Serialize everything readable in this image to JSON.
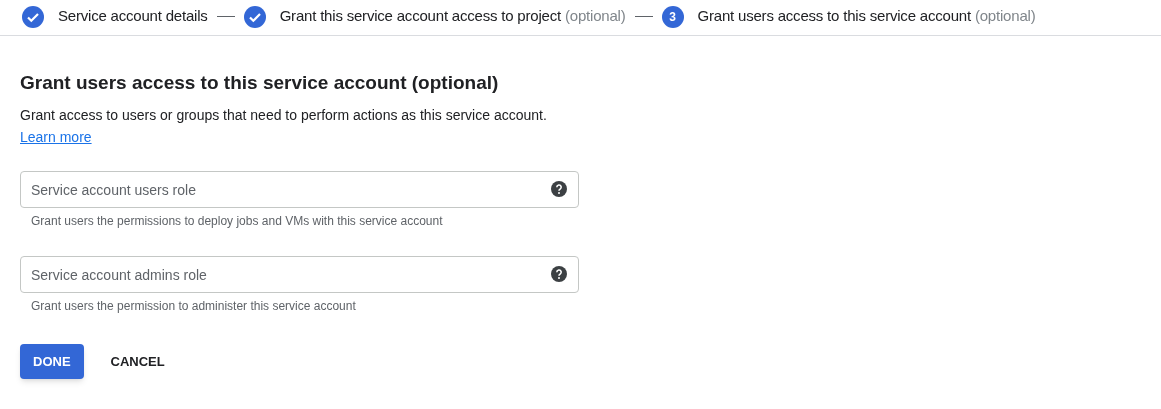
{
  "stepper": [
    {
      "label": "Service account details",
      "completed": true
    },
    {
      "label": "Grant this service account access to project",
      "note": "(optional)",
      "completed": true
    },
    {
      "label": "Grant users access to this service account",
      "note": "(optional)",
      "completed": false,
      "number": "3"
    }
  ],
  "section": {
    "title": "Grant users access to this service account (optional)",
    "description": "Grant access to users or groups that need to perform actions as this service account.",
    "link": "Learn more"
  },
  "fields": [
    {
      "placeholder": "Service account users role",
      "hint": "Grant users the permissions to deploy jobs and VMs with this service account"
    },
    {
      "placeholder": "Service account admins role",
      "hint": "Grant users the permission to administer this service account"
    }
  ],
  "buttons": [
    {
      "label": "DONE",
      "kind": "primary"
    },
    {
      "label": "CANCEL",
      "kind": "text"
    }
  ]
}
